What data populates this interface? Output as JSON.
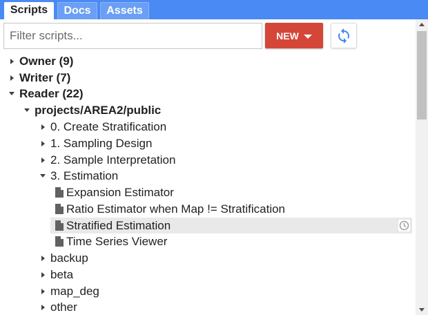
{
  "tabs": [
    {
      "label": "Scripts",
      "active": true
    },
    {
      "label": "Docs",
      "active": false
    },
    {
      "label": "Assets",
      "active": false
    }
  ],
  "toolbar": {
    "filter_placeholder": "Filter scripts...",
    "filter_value": "",
    "new_label": "NEW",
    "refresh_icon": "refresh-icon"
  },
  "tree": {
    "owner": "Owner (9)",
    "writer": "Writer (7)",
    "reader": "Reader (22)",
    "repo": "projects/AREA2/public",
    "folders": {
      "f0": "0. Create Stratification",
      "f1": "1. Sampling Design",
      "f2": "2. Sample Interpretation",
      "f3": "3. Estimation",
      "backup": "backup",
      "beta": "beta",
      "map_deg": "map_deg",
      "other": "other"
    },
    "files": {
      "expansion": "Expansion Estimator",
      "ratio": "Ratio Estimator when Map != Stratification",
      "stratified": "Stratified Estimation",
      "timeseries": "Time Series Viewer"
    },
    "selected_item": "Stratified Estimation"
  },
  "colors": {
    "tabbar": "#4a8af4",
    "new_button": "#d44638",
    "refresh_icon": "#4285f4",
    "selected_row": "#e9e9e9"
  }
}
